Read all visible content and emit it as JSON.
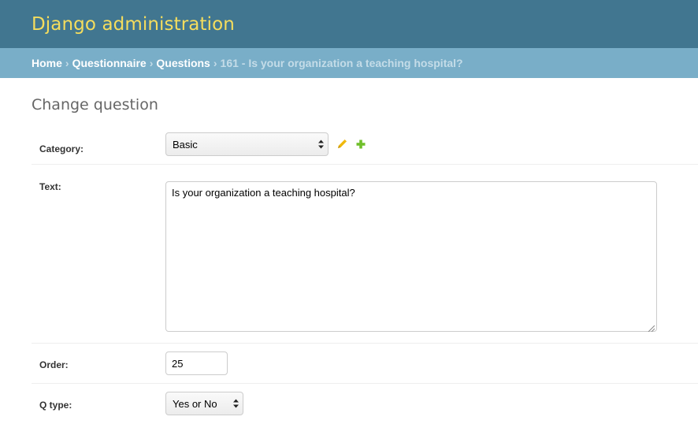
{
  "header": {
    "title": "Django administration"
  },
  "breadcrumbs": {
    "home": "Home",
    "app": "Questionnaire",
    "model": "Questions",
    "current": "161 - Is your organization a teaching hospital?",
    "separator": "›"
  },
  "page": {
    "title": "Change question"
  },
  "form": {
    "category": {
      "label": "Category:",
      "selected": "Basic"
    },
    "text": {
      "label": "Text:",
      "value": "Is your organization a teaching hospital?"
    },
    "order": {
      "label": "Order:",
      "value": "25"
    },
    "q_type": {
      "label": "Q type:",
      "selected": "Yes or No"
    }
  },
  "icons": {
    "change": "pencil-icon",
    "add": "plus-icon",
    "select_arrows": "updown-arrows-icon",
    "resize": "resize-grip-icon"
  },
  "colors": {
    "header_bg": "#417690",
    "branding": "#f5dd5d",
    "breadcrumbs_bg": "#79aec8",
    "change_icon": "#efb80b",
    "add_icon": "#70bf2b"
  }
}
